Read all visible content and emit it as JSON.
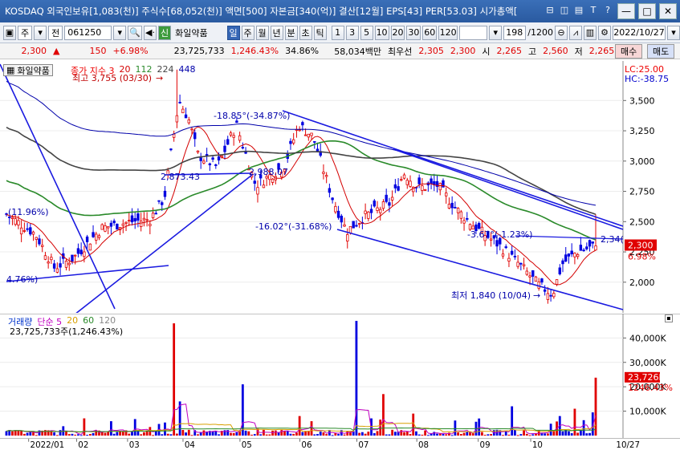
{
  "window": {
    "title": "KOSDAQ 외국인보유[1,083(천)] 주식수[68,052(천)] 액면[500] 자본금[340(억)] 결산[12월] EPS[43] PER[53.03] 시가총액[",
    "icons": [
      "window-icon",
      "restore-icon",
      "tile-icon",
      "font-icon",
      "question-icon",
      "minimize-icon",
      "maximize-icon",
      "close-icon"
    ],
    "question_label": "?",
    "font_label": "T"
  },
  "toolbar": {
    "market": "주",
    "type": "전",
    "code": "061250",
    "stock_badge": "신",
    "stock_name": "화일약품",
    "periods": [
      "일",
      "주",
      "월",
      "년",
      "분",
      "초",
      "틱"
    ],
    "active_period": "일",
    "intervals": [
      "1",
      "3",
      "5",
      "10",
      "20",
      "30",
      "60",
      "120"
    ],
    "count": "198",
    "total": "/1200",
    "date": "2022/10/27"
  },
  "quote": {
    "price": "2,300",
    "arrow": "▲",
    "change": "150",
    "change_pct": "+6.98%",
    "volume": "23,725,733",
    "vol_ratio": "1,246.43%",
    "turnover": "34.86%",
    "trade_amount": "58,034백만",
    "pref_label": "최우선",
    "best_ask": "2,305",
    "best_bid": "2,300",
    "open_label": "시",
    "open": "2,265",
    "high_label": "고",
    "high": "2,560",
    "low_label": "저",
    "low": "2,265",
    "sell_label": "매수",
    "buy_label": "매도"
  },
  "price_pane": {
    "stock_tag": "화일약품",
    "ma_legend_label": "종가 지수 3",
    "ma_legend": [
      "20",
      "112",
      "224",
      "448"
    ],
    "lc": "LC:25.00",
    "hc": "HC:-38.75",
    "annotations": {
      "max": "최고 3,755 (03/30)",
      "min": "최저 1,840 (10/04)",
      "a1": "-18.85°(-34.87%)",
      "a2": "2,873.43",
      "a3": "2,988.07",
      "a4": "-16.02°(-31.68%)",
      "a5": "-3.67°(-1.23%)",
      "a6": "(11.96%)",
      "a7": "4.76%)",
      "a8": "2,34("
    },
    "current_price": "2,300",
    "current_pct": "6.98%"
  },
  "volume_pane": {
    "legend_label": "거래량",
    "legend_items": [
      "단순 5",
      "20",
      "60",
      "120"
    ],
    "summary": "23,725,733주(1,246.43%)",
    "current_vol": "23,726K",
    "current_pct": "1246.43%"
  },
  "chart_data": {
    "type": "candlestick",
    "price_axis": {
      "ticks": [
        "3,500",
        "3,250",
        "3,000",
        "2,750",
        "2,500",
        "2,250",
        "2,000"
      ],
      "ylim": [
        1800,
        3800
      ]
    },
    "volume_axis": {
      "ticks": [
        "40,000K",
        "30,000K",
        "20,000K",
        "10,000K"
      ],
      "ylim": [
        0,
        48000
      ]
    },
    "x_labels": [
      "2022/01",
      "02",
      "03",
      "04",
      "05",
      "06",
      "07",
      "08",
      "09",
      "10",
      "10/27"
    ],
    "summary": {
      "high": 3755,
      "high_date": "03/30",
      "low": 1840,
      "low_date": "10/04",
      "last_close": 2300,
      "last_volume_k": 23726
    },
    "colors": {
      "up": "#e00000",
      "down": "#0000e0",
      "ma20": "#d40000",
      "ma112": "#2a8a2a",
      "ma224": "#444444",
      "ma448": "#0000aa"
    }
  }
}
